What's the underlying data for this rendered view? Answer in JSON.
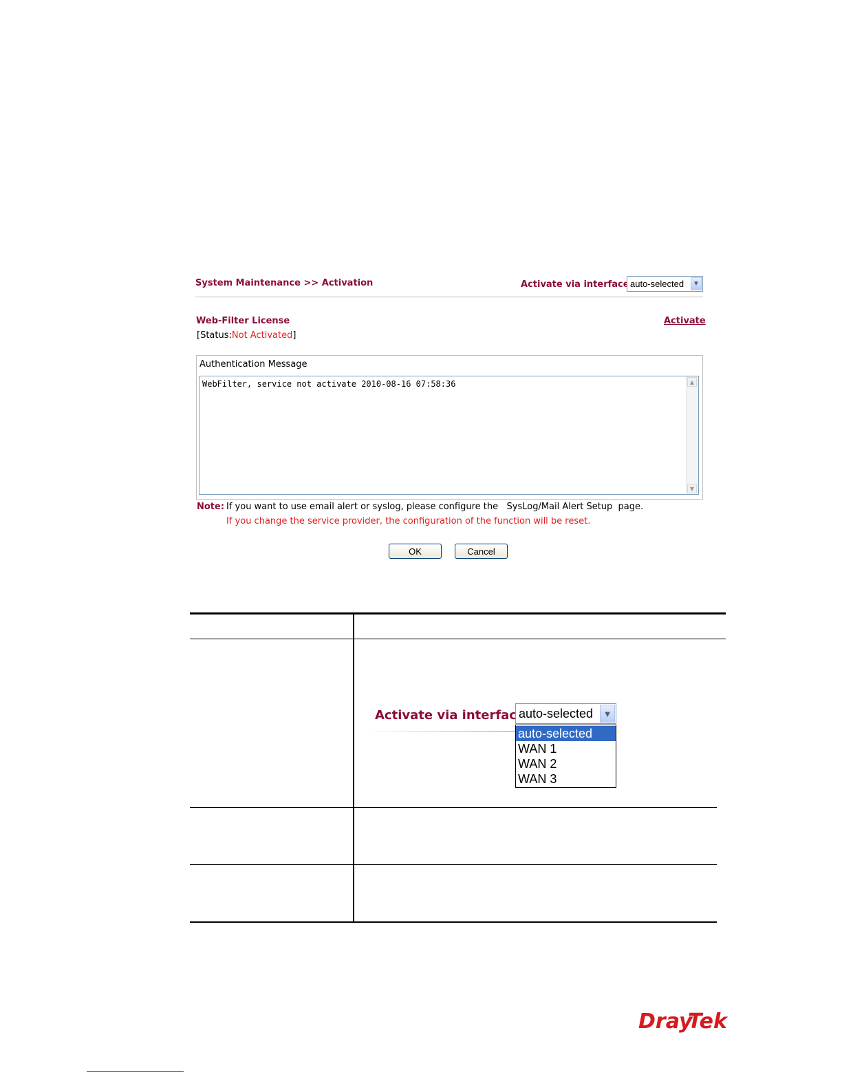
{
  "panel": {
    "breadcrumb": "System Maintenance >> Activation",
    "interface_label": "Activate via interface :",
    "interface_value": "auto-selected",
    "license_title": "Web-Filter License",
    "activate_link": "Activate",
    "status_prefix": "[Status:",
    "status_value": "Not Activated",
    "status_suffix": "]",
    "auth_title": "Authentication Message",
    "auth_message": "WebFilter, service not activate 2010-08-16 07:58:36",
    "note_label": "Note:",
    "note_line1": "If you want to use email alert or syslog, please configure the   SysLog/Mail Alert Setup  page.",
    "note_line2": "If you change the service provider, the configuration of the function will be reset.",
    "ok_label": "OK",
    "cancel_label": "Cancel"
  },
  "zoomed_dropdown": {
    "label": "Activate via interface :",
    "selected": "auto-selected",
    "options": [
      "auto-selected",
      "WAN 1",
      "WAN 2",
      "WAN 3"
    ]
  },
  "footer": {
    "logo_text_dray": "Dray",
    "logo_text_tek": "Tek"
  },
  "colors": {
    "label_maroon": "#8b0d3a",
    "status_red": "#e02020",
    "selected_option": "#316ac5",
    "logo_red": "#d71920"
  }
}
